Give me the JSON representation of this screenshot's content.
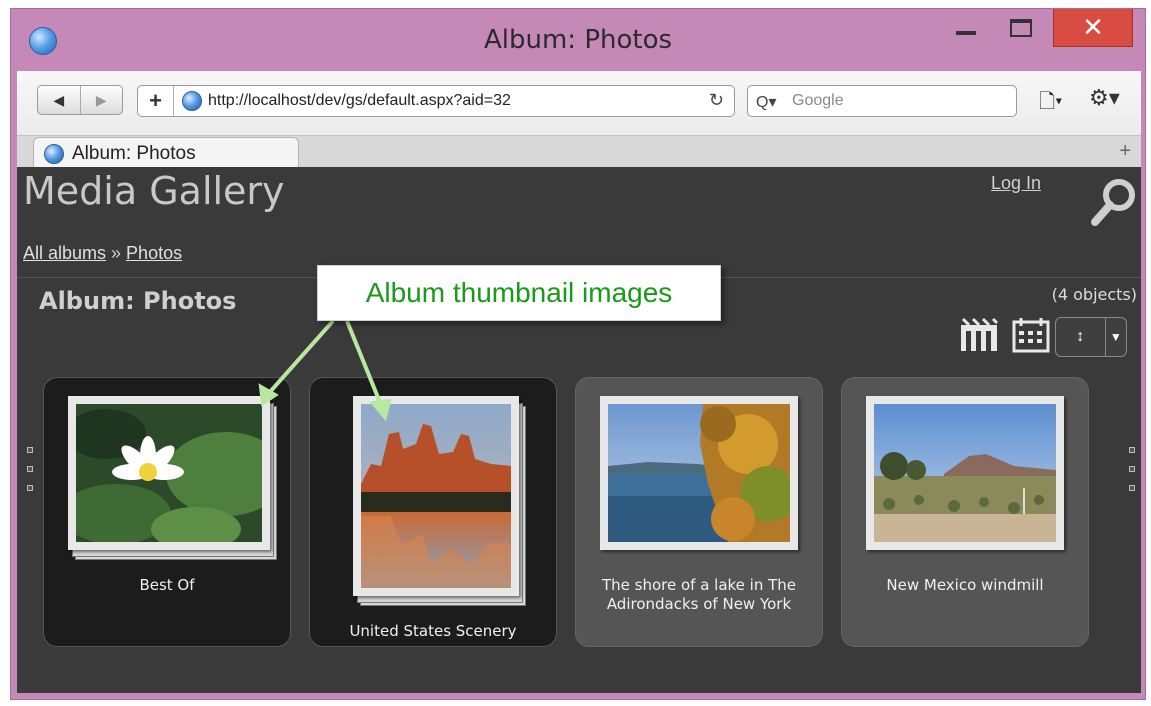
{
  "window": {
    "title": "Album: Photos",
    "close_glyph": "✕"
  },
  "toolbar": {
    "back_glyph": "◀",
    "forward_glyph": "▶",
    "new_glyph": "+",
    "url": "http://localhost/dev/gs/default.aspx?aid=32",
    "reload_glyph": "↻",
    "search_placeholder": "Google",
    "search_glyph": "Q▾",
    "page_glyph": "🗋▾",
    "tools_glyph": "⚙▾"
  },
  "tabs": [
    {
      "label": "Album: Photos",
      "active": true
    }
  ],
  "new_tab_glyph": "+",
  "site": {
    "title": "Media Gallery",
    "login_label": "Log In"
  },
  "breadcrumb": {
    "root": "All albums",
    "separator": " » ",
    "current": "Photos"
  },
  "album": {
    "heading": "Album: Photos",
    "count_label": "(4 objects)",
    "sort_glyph": "↕",
    "sort_drop_glyph": "▼"
  },
  "callout": {
    "text": "Album thumbnail images"
  },
  "items": [
    {
      "caption": "Best Of",
      "type": "album"
    },
    {
      "caption": "United States Scenery",
      "type": "album"
    },
    {
      "caption": "The shore of a lake in The Adirondacks of New York",
      "type": "photo"
    },
    {
      "caption": "New Mexico windmill",
      "type": "photo"
    }
  ],
  "colors": {
    "window_frame": "#c589b8",
    "page_background": "#3a3a3a",
    "callout_text": "#1a9a1a",
    "close_button": "#d94c42"
  }
}
